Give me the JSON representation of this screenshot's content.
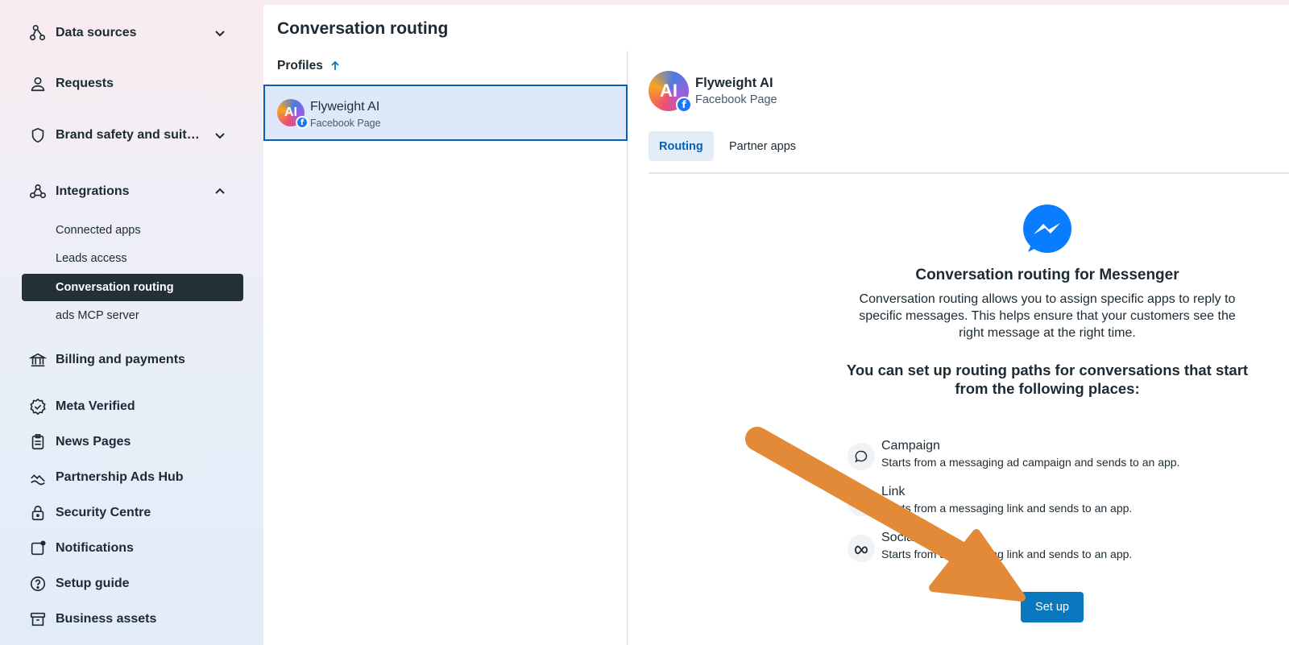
{
  "sidebar": {
    "items": [
      {
        "label": "Data sources",
        "icon": "data-sources-icon",
        "expandable": true,
        "expanded": false
      },
      {
        "label": "Requests",
        "icon": "person-icon"
      },
      {
        "label": "Brand safety and suit…",
        "icon": "shield-icon",
        "expandable": true,
        "expanded": false
      },
      {
        "label": "Integrations",
        "icon": "integrations-icon",
        "expandable": true,
        "expanded": true
      },
      {
        "label": "Billing and payments",
        "icon": "bank-icon"
      },
      {
        "label": "Meta Verified",
        "icon": "verified-badge-icon"
      },
      {
        "label": "News Pages",
        "icon": "clipboard-icon"
      },
      {
        "label": "Partnership Ads Hub",
        "icon": "partnership-icon"
      },
      {
        "label": "Security Centre",
        "icon": "lock-icon"
      },
      {
        "label": "Notifications",
        "icon": "notification-icon"
      },
      {
        "label": "Setup guide",
        "icon": "question-icon"
      },
      {
        "label": "Business assets",
        "icon": "archive-icon"
      }
    ],
    "integrations_sub": [
      {
        "label": "Connected apps",
        "active": false
      },
      {
        "label": "Leads access",
        "active": false
      },
      {
        "label": "Conversation routing",
        "active": true
      },
      {
        "label": "ads MCP server",
        "active": false
      }
    ]
  },
  "main": {
    "title": "Conversation routing",
    "profiles_header": "Profiles",
    "profile": {
      "avatar_text": "AI",
      "name": "Flyweight AI",
      "type": "Facebook Page"
    },
    "detail": {
      "name": "Flyweight AI",
      "type": "Facebook Page",
      "tabs": [
        {
          "label": "Routing",
          "active": true
        },
        {
          "label": "Partner apps",
          "active": false
        }
      ],
      "heading": "Conversation routing for Messenger",
      "description": "Conversation routing allows you to assign specific apps to reply to specific messages. This helps ensure that your customers see the right message at the right time.",
      "subheading": "You can set up routing paths for conversations that start from the following places:",
      "places": [
        {
          "title": "Campaign",
          "desc": "Starts from a messaging ad campaign and sends to an app.",
          "icon": "chat-bubble-icon"
        },
        {
          "title": "Link",
          "desc": "Starts from a messaging link and sends to an app.",
          "icon": "link-icon"
        },
        {
          "title": "Social",
          "desc": "Starts from a messaging link and sends to an app.",
          "icon": "meta-icon"
        }
      ],
      "setup_button": "Set up"
    }
  },
  "colors": {
    "accent": "#0a78be",
    "active_nav_bg": "#243038",
    "selected_row_bg": "#dde9fa",
    "arrow": "#e28a37",
    "messenger_blue": "#0a7cff"
  }
}
